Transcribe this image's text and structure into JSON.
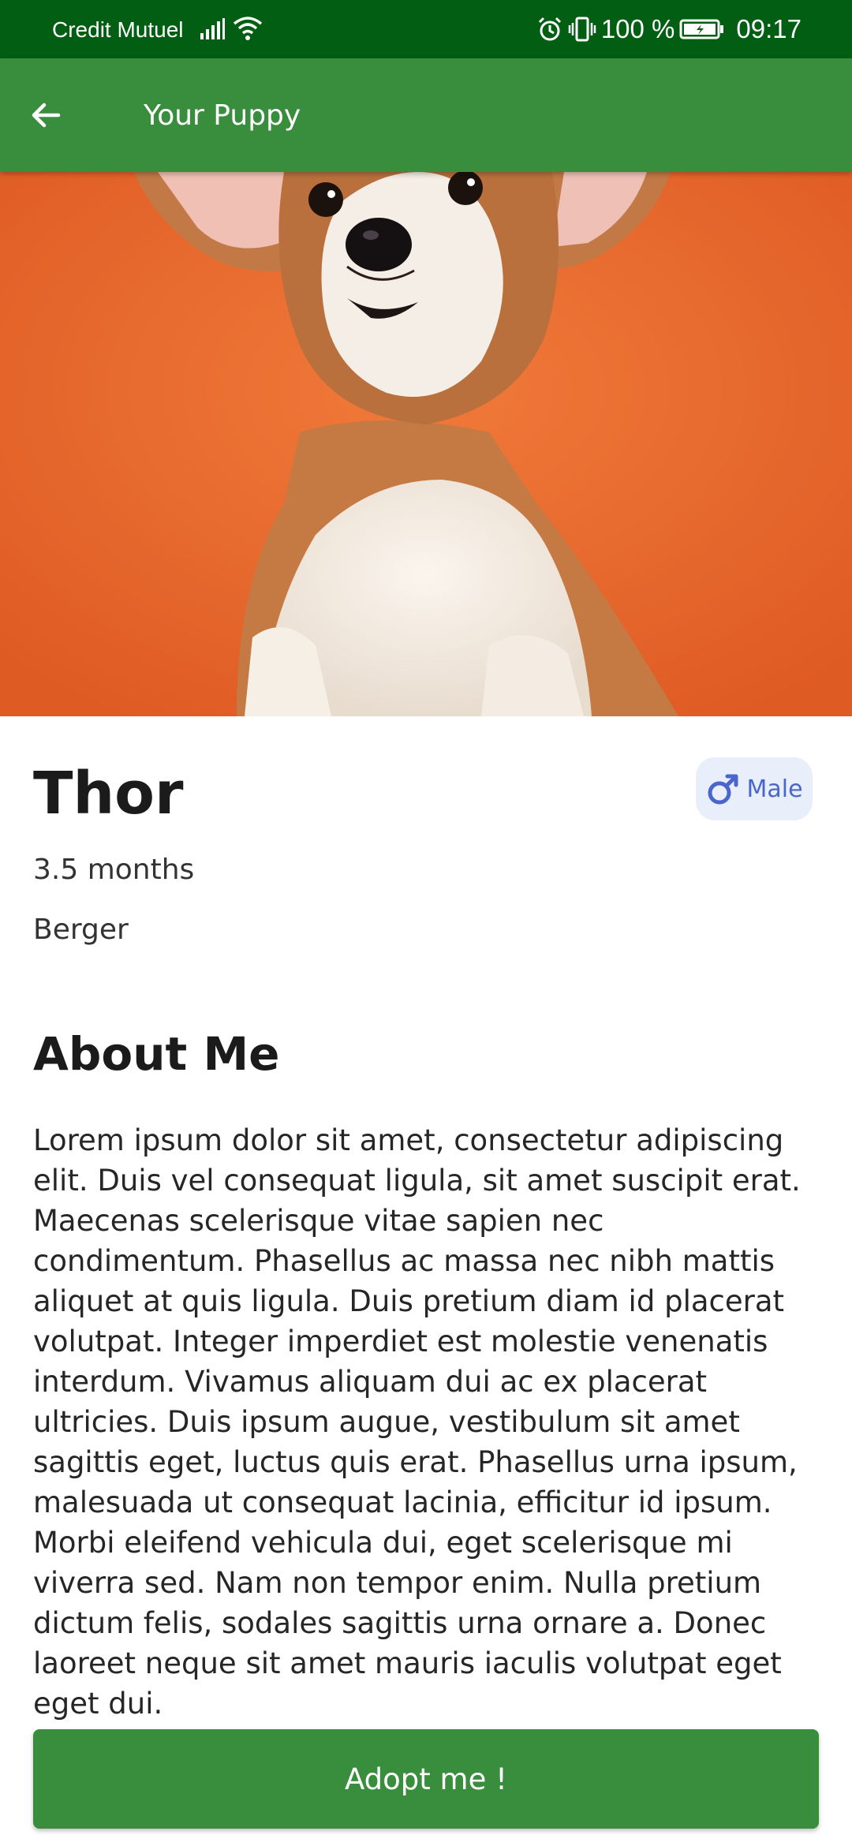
{
  "status_bar": {
    "carrier": "Credit Mutuel",
    "battery": "100 %",
    "time": "09:17"
  },
  "app_bar": {
    "title": "Your Puppy"
  },
  "puppy": {
    "name": "Thor",
    "gender": "Male",
    "age": "3.5 months",
    "breed": "Berger"
  },
  "about": {
    "heading": "About Me",
    "text": "Lorem ipsum dolor sit amet, consectetur adipiscing elit. Duis vel consequat ligula, sit amet suscipit erat. Maecenas scelerisque vitae sapien nec condimentum. Phasellus ac massa nec nibh mattis aliquet at quis ligula. Duis pretium diam id placerat volutpat. Integer imperdiet est molestie venenatis interdum. Vivamus aliquam dui ac ex placerat ultricies. Duis ipsum augue, vestibulum sit amet sagittis eget, luctus quis erat. Phasellus urna ipsum, malesuada ut consequat lacinia, efficitur id ipsum. Morbi eleifend vehicula dui, eget scelerisque mi viverra sed. Nam non tempor enim. Nulla pretium dictum felis, sodales sagittis urna ornare a. Donec laoreet neque sit amet mauris iaculis volutpat eget eget dui."
  },
  "actions": {
    "adopt_label": "Adopt me !"
  },
  "icons": {
    "back": "arrow-back-icon",
    "gender": "male-icon",
    "signal": "signal-icon",
    "wifi": "wifi-icon",
    "alarm": "alarm-icon",
    "vibrate": "vibrate-icon",
    "battery": "battery-icon"
  },
  "colors": {
    "status_bar": "#015e13",
    "primary": "#388e3c",
    "chip_bg": "#e9eefb",
    "chip_fg": "#4a66cc",
    "hero_bg": "#e8662c"
  }
}
